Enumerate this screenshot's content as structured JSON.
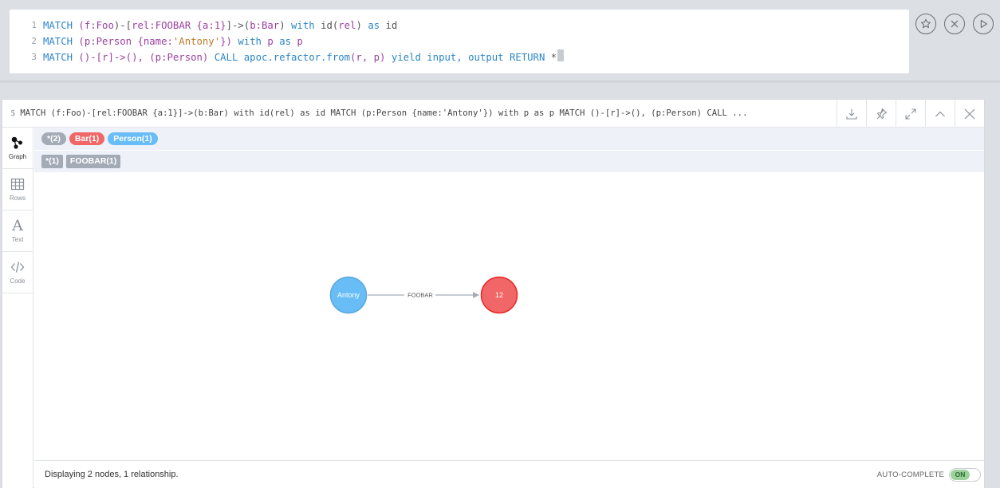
{
  "editor": {
    "lines": [
      {
        "number": "1",
        "tokens": [
          {
            "t": "MATCH ",
            "c": "kw"
          },
          {
            "t": "(f",
            "c": "lb"
          },
          {
            "t": ":Foo",
            "c": "lb"
          },
          {
            "t": ")-[",
            "c": "tx"
          },
          {
            "t": "rel",
            "c": "lb"
          },
          {
            "t": ":FOOBAR",
            "c": "lb"
          },
          {
            "t": " {a:",
            "c": "lb"
          },
          {
            "t": "1",
            "c": "lb"
          },
          {
            "t": "}",
            "c": "lb"
          },
          {
            "t": "]->(",
            "c": "tx"
          },
          {
            "t": "b",
            "c": "lb"
          },
          {
            "t": ":Bar",
            "c": "lb"
          },
          {
            "t": ") ",
            "c": "tx"
          },
          {
            "t": "with ",
            "c": "kw"
          },
          {
            "t": "id",
            "c": "tx"
          },
          {
            "t": "(",
            "c": "tx"
          },
          {
            "t": "rel",
            "c": "lb"
          },
          {
            "t": ") ",
            "c": "tx"
          },
          {
            "t": "as ",
            "c": "kw"
          },
          {
            "t": "id",
            "c": "tx"
          }
        ]
      },
      {
        "number": "2",
        "tokens": [
          {
            "t": "MATCH ",
            "c": "kw"
          },
          {
            "t": "(p",
            "c": "lb"
          },
          {
            "t": ":Person",
            "c": "lb"
          },
          {
            "t": " {name:",
            "c": "lb"
          },
          {
            "t": "'Antony'",
            "c": "st"
          },
          {
            "t": "}) ",
            "c": "lb"
          },
          {
            "t": "with ",
            "c": "kw"
          },
          {
            "t": "p ",
            "c": "lb"
          },
          {
            "t": "as ",
            "c": "kw"
          },
          {
            "t": "p",
            "c": "lb"
          }
        ]
      },
      {
        "number": "3",
        "tokens": [
          {
            "t": "MATCH ",
            "c": "kw"
          },
          {
            "t": "()-[",
            "c": "lb"
          },
          {
            "t": "r",
            "c": "lb"
          },
          {
            "t": "]->(), ",
            "c": "lb"
          },
          {
            "t": "(p",
            "c": "lb"
          },
          {
            "t": ":Person",
            "c": "lb"
          },
          {
            "t": ") ",
            "c": "lb"
          },
          {
            "t": "CALL ",
            "c": "kw"
          },
          {
            "t": "apoc.refactor.from",
            "c": "fn"
          },
          {
            "t": "(r, p) ",
            "c": "lb"
          },
          {
            "t": "yield ",
            "c": "kw"
          },
          {
            "t": "input, ",
            "c": "kw"
          },
          {
            "t": "output ",
            "c": "kw"
          },
          {
            "t": "RETURN ",
            "c": "kw"
          },
          {
            "t": "*",
            "c": "tx"
          }
        ]
      }
    ]
  },
  "editor_actions": {
    "favorite_icon": "star-icon",
    "clear_icon": "close-circle-icon",
    "run_icon": "play-icon"
  },
  "frame": {
    "prompt": "$",
    "query": "MATCH (f:Foo)-[rel:FOOBAR {a:1}]->(b:Bar) with id(rel) as id MATCH (p:Person {name:'Antony'}) with p as p MATCH ()-[r]->(), (p:Person) CALL ..."
  },
  "views": [
    {
      "label": "Graph",
      "icon": "graph-icon",
      "active": true
    },
    {
      "label": "Rows",
      "icon": "table-icon",
      "active": false
    },
    {
      "label": "Text",
      "icon": "text-icon",
      "active": false
    },
    {
      "label": "Code",
      "icon": "code-icon",
      "active": false
    }
  ],
  "legend": {
    "labels": [
      {
        "text": "*(2)",
        "color": "#a5abb6"
      },
      {
        "text": "Bar(1)",
        "color": "#f16667"
      },
      {
        "text": "Person(1)",
        "color": "#68bdf6"
      }
    ],
    "relationships": [
      {
        "text": "*(1)"
      },
      {
        "text": "FOOBAR(1)"
      }
    ]
  },
  "graph": {
    "nodes": [
      {
        "id": "antony",
        "caption": "Antony",
        "fill": "#68bdf6",
        "stroke": "#5ca8db"
      },
      {
        "id": "bar12",
        "caption": "12",
        "fill": "#f16667",
        "stroke": "#eb2728"
      }
    ],
    "relationship": {
      "type": "FOOBAR",
      "from": "antony",
      "to": "bar12"
    }
  },
  "status": {
    "text": "Displaying 2 nodes, 1 relationship.",
    "autocomplete_label": "AUTO-COMPLETE",
    "toggle_state": "ON"
  }
}
